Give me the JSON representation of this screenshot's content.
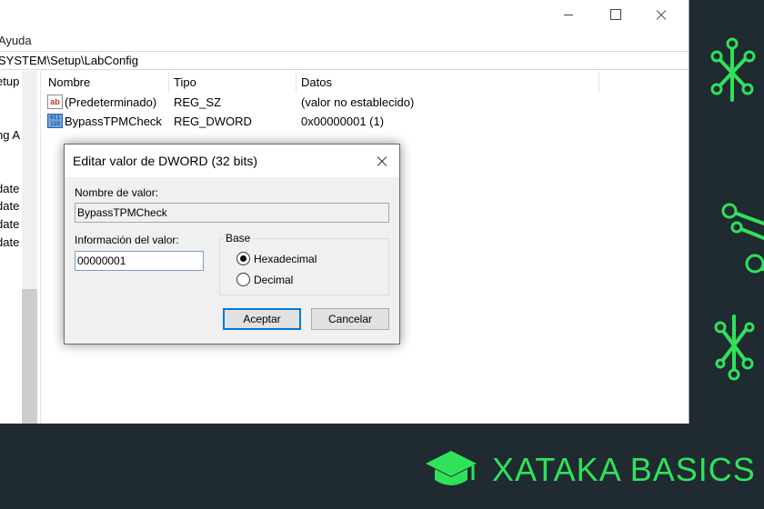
{
  "regedit": {
    "menu_visible": "Ayuda",
    "address": "SYSTEM\\Setup\\LabConfig",
    "tree_items": [
      "etup",
      "ng A",
      "date",
      "date",
      "date",
      "date"
    ],
    "columns": [
      "Nombre",
      "Tipo",
      "Datos"
    ],
    "rows": [
      {
        "name": "(Predeterminado)",
        "type": "REG_SZ",
        "data": "(valor no establecido)",
        "icon": "string-value-icon"
      },
      {
        "name": "BypassTPMCheck",
        "type": "REG_DWORD",
        "data": "0x00000001 (1)",
        "icon": "binary-value-icon"
      }
    ],
    "icons": {
      "ab": "ab",
      "bin": "011 110"
    }
  },
  "dialog": {
    "title": "Editar valor de DWORD (32 bits)",
    "value_name_label": "Nombre de valor:",
    "value_name": "BypassTPMCheck",
    "value_data_label": "Información del valor:",
    "value_data": "00000001",
    "base_label": "Base",
    "base_options": [
      {
        "label": "Hexadecimal",
        "selected": true
      },
      {
        "label": "Decimal",
        "selected": false
      }
    ],
    "ok_label": "Aceptar",
    "cancel_label": "Cancelar"
  },
  "brand": {
    "text": "XATAKA BASICS",
    "color": "#2fe25a",
    "background": "#1f2a31"
  }
}
